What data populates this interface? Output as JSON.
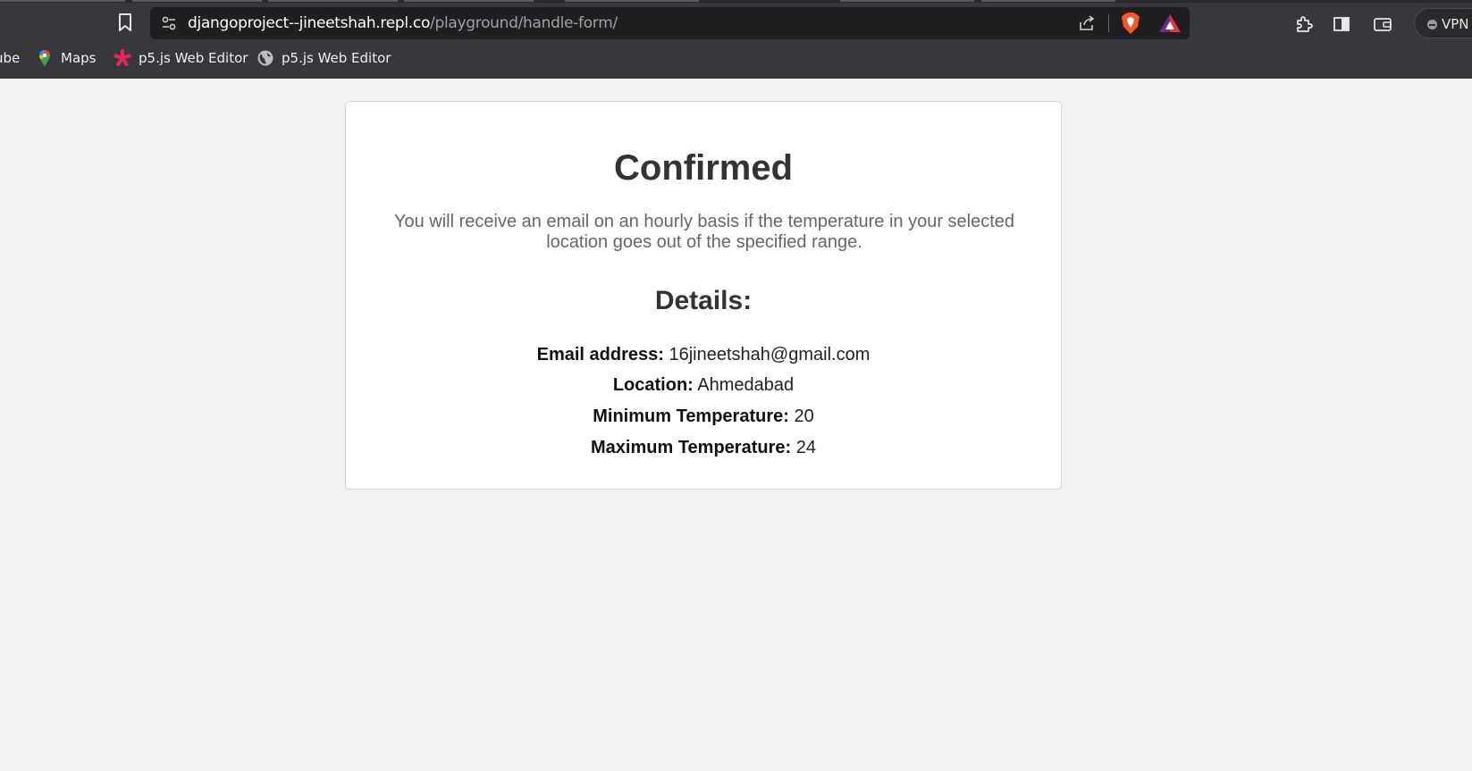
{
  "browser": {
    "url_host": "djangoproject--jineetshah.repl.co",
    "url_path": "/playground/handle-form/",
    "vpn_label": "VPN",
    "bookmarks": [
      {
        "label": "ube",
        "icon": "youtube-icon"
      },
      {
        "label": "Maps",
        "icon": "maps-icon"
      },
      {
        "label": "p5.js Web Editor",
        "icon": "p5js-asterisk-icon"
      },
      {
        "label": "p5.js Web Editor",
        "icon": "globe-icon"
      }
    ]
  },
  "card": {
    "title": "Confirmed",
    "message": "You will receive an email on an hourly basis if the temperature in your selected location goes out of the specified range.",
    "details_heading": "Details:",
    "details": [
      {
        "label": "Email address:",
        "value": "16jineetshah@gmail.com"
      },
      {
        "label": "Location:",
        "value": "Ahmedabad"
      },
      {
        "label": "Minimum Temperature:",
        "value": "20"
      },
      {
        "label": "Maximum Temperature:",
        "value": "24"
      }
    ]
  },
  "colors": {
    "chrome_bg": "#38383c",
    "omnibox_bg": "#1f1f21",
    "page_bg": "#f1f1f1",
    "card_bg": "#ffffff",
    "heading": "#333333",
    "message": "#666666"
  }
}
